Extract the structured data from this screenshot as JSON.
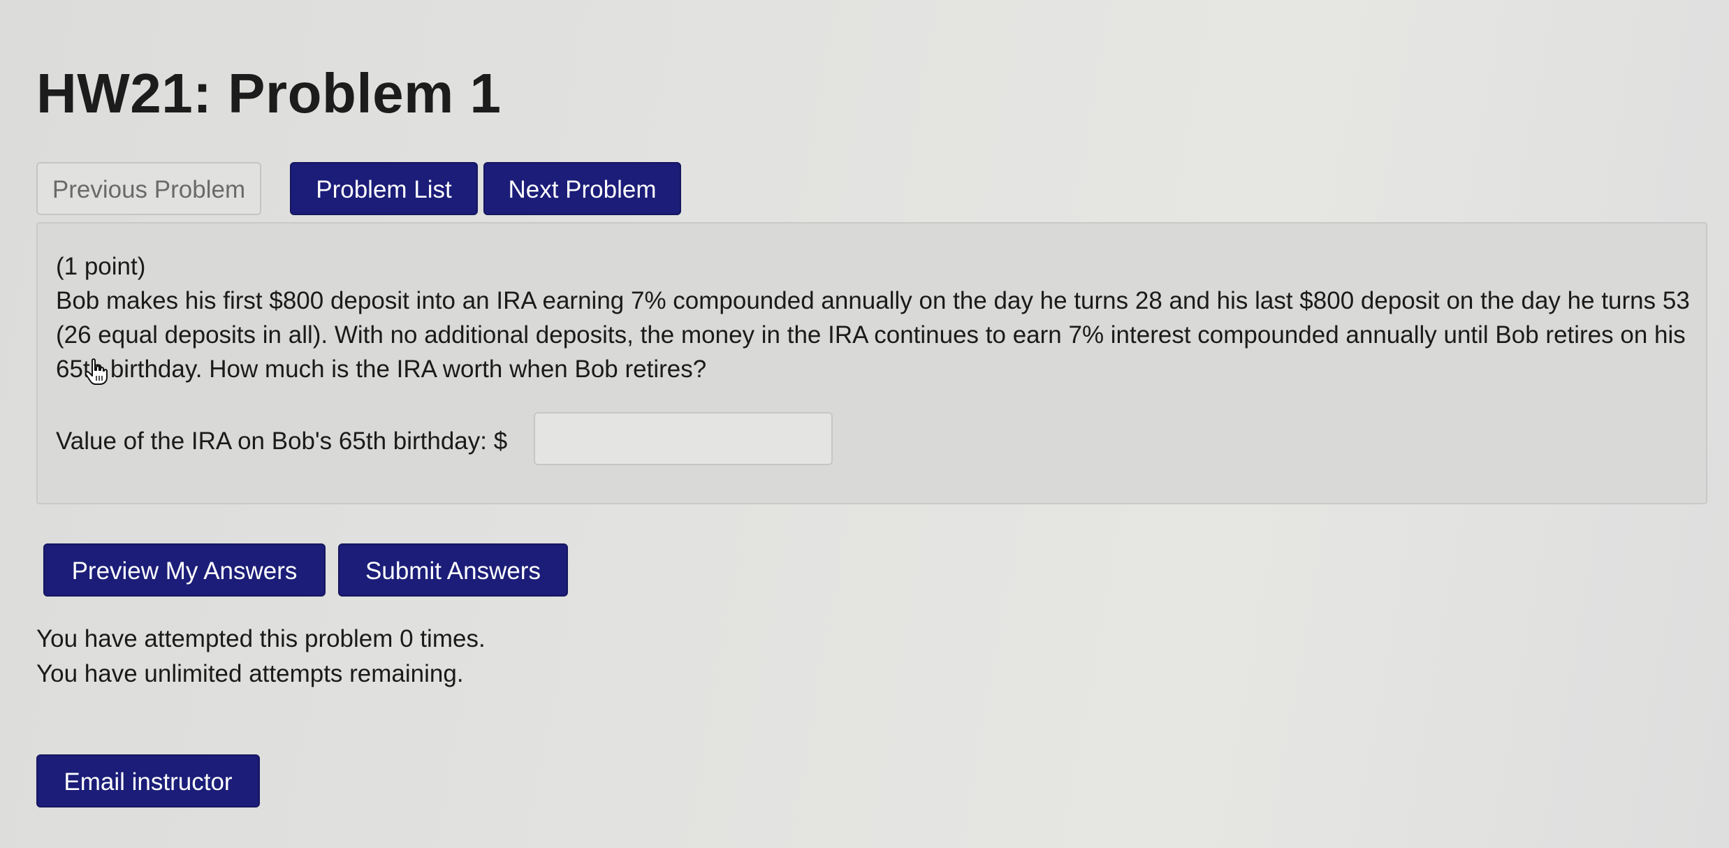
{
  "page_title": "HW21: Problem 1",
  "nav": {
    "previous": "Previous Problem",
    "list": "Problem List",
    "next": "Next Problem"
  },
  "problem": {
    "points": "(1 point)",
    "text": "Bob makes his first $800 deposit into an IRA earning 7% compounded annually on the day he turns 28 and his last $800 deposit on the day he turns 53 (26 equal deposits in all). With no additional deposits, the money in the IRA continues to earn 7% interest compounded annually until Bob retires on his 65th birthday. How much is the IRA worth when Bob retires?",
    "answer_label": "Value of the IRA on Bob's 65th birthday: $",
    "answer_value": ""
  },
  "actions": {
    "preview": "Preview My Answers",
    "submit": "Submit Answers"
  },
  "attempts": {
    "line1": "You have attempted this problem 0 times.",
    "line2": "You have unlimited attempts remaining."
  },
  "email": "Email instructor",
  "colors": {
    "primary_button": "#1b1d78",
    "disabled_button": "#e1e1df",
    "problem_box": "#d9d9d7"
  },
  "icons": {
    "cursor": "hand-pointer-icon"
  }
}
